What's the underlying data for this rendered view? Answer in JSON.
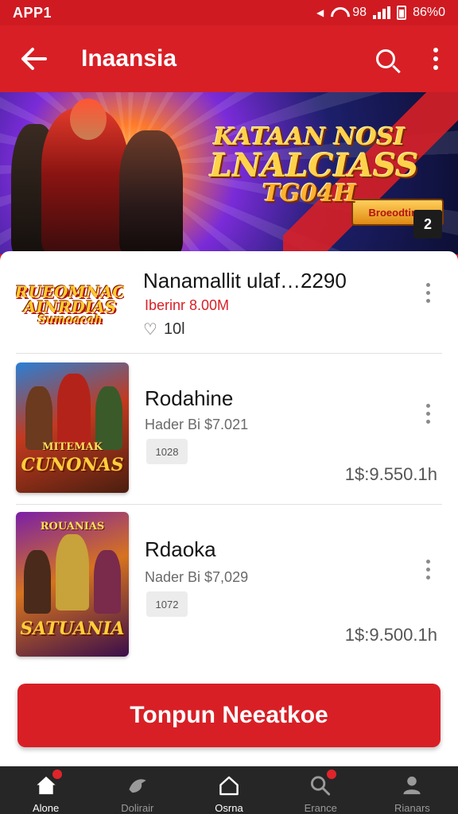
{
  "status_bar": {
    "time": "APP1",
    "extra": "ᯤ",
    "label": "98",
    "battery": "86%0"
  },
  "app_bar": {
    "title": "Inaansia",
    "back_icon": "arrow-left-icon",
    "search_icon": "search-icon",
    "menu_icon": "more-vertical-icon"
  },
  "banner": {
    "title_line1": "KATAAN NOSI",
    "title_line2": "LNALCIASS",
    "title_line3": "TG04H",
    "badge": "Broeodtimu",
    "corner": "2"
  },
  "items": [
    {
      "logo_line1": "RUEOMNAC",
      "logo_line2": "AINRDIAS",
      "logo_line3": "Sumoacah",
      "title": "Nanamallit ulaf…2290",
      "subtitle": "Iberinr 8.00M",
      "rating": "10l",
      "rating_icon": "heart-icon",
      "menu_icon": "more-vertical-icon"
    },
    {
      "poster_top": "MITEMAK",
      "poster_caption": "CUNONAS",
      "title": "Rodahine",
      "subtitle": "Hader Bi $7.021",
      "chip": "1028",
      "price": "1$:9.550.1h",
      "menu_icon": "more-vertical-icon"
    },
    {
      "poster_top": "ROUANIAS",
      "poster_caption": "SATUANIA",
      "title": "Rdaoka",
      "subtitle": "Nader Bi $7,029",
      "chip": "1072",
      "price": "1$:9.500.1h",
      "menu_icon": "more-vertical-icon"
    }
  ],
  "cta": {
    "label": "Tonpun Neeatkoe"
  },
  "bottom_nav": [
    {
      "label": "Alone",
      "icon": "home-icon",
      "badge": true
    },
    {
      "label": "Dolirair",
      "icon": "bird-icon",
      "badge": false
    },
    {
      "label": "Osrna",
      "icon": "house-outline-icon",
      "badge": false
    },
    {
      "label": "Erance",
      "icon": "search-icon",
      "badge": true
    },
    {
      "label": "Rianars",
      "icon": "person-icon",
      "badge": false
    }
  ],
  "colors": {
    "brand_red": "#d81f26",
    "nav_background": "#262626"
  }
}
